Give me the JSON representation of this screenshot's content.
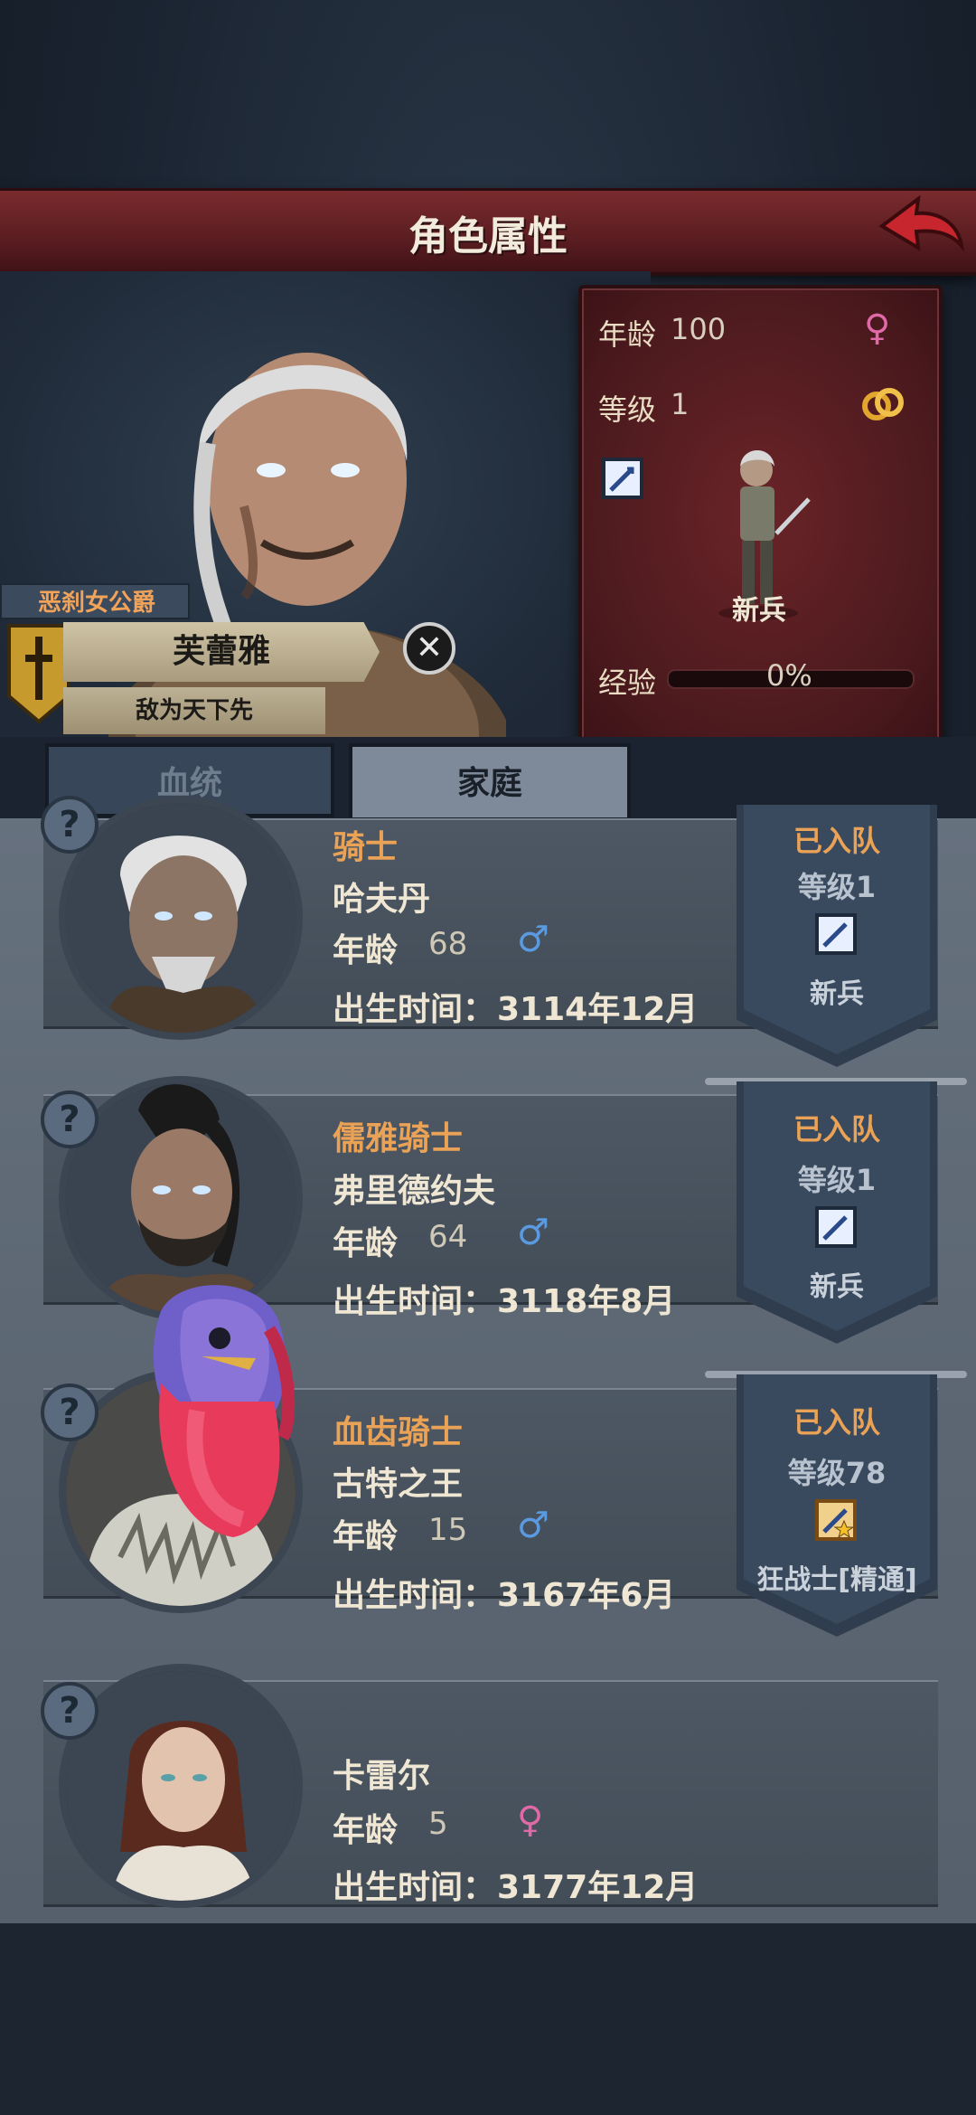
{
  "header": {
    "title": "角色属性"
  },
  "character": {
    "title_tag": "恶刹女公爵",
    "name": "芙蕾雅",
    "motto": "敌为天下先",
    "stats": {
      "age_label": "年龄",
      "age_value": "100",
      "level_label": "等级",
      "level_value": "1",
      "class_name": "新兵",
      "exp_label": "经验",
      "exp_value": "0%",
      "exp_fraction": 0
    }
  },
  "tabs": [
    {
      "label": "血统",
      "active": false
    },
    {
      "label": "家庭",
      "active": true
    }
  ],
  "family": [
    {
      "title": "骑士",
      "name": "哈夫丹",
      "age_label": "年龄",
      "age": "68",
      "gender": "male",
      "birth_label": "出生时间：",
      "birth": "3114年12月",
      "status": "已入队",
      "level": "等级1",
      "class": "新兵",
      "elite": false
    },
    {
      "title": "儒雅骑士",
      "name": "弗里德约夫",
      "age_label": "年龄",
      "age": "64",
      "gender": "male",
      "birth_label": "出生时间：",
      "birth": "3118年8月",
      "status": "已入队",
      "level": "等级1",
      "class": "新兵",
      "elite": false
    },
    {
      "title": "血齿骑士",
      "name": "古特之王",
      "age_label": "年龄",
      "age": "15",
      "gender": "male",
      "birth_label": "出生时间：",
      "birth": "3167年6月",
      "status": "已入队",
      "level": "等级78",
      "class": "狂战士[精通]",
      "elite": true
    },
    {
      "title": "",
      "name": "卡雷尔",
      "age_label": "年龄",
      "age": "5",
      "gender": "female",
      "birth_label": "出生时间：",
      "birth": "3177年12月"
    }
  ],
  "icons": {
    "female": "♀",
    "male": "♂",
    "unknown": "?",
    "close": "✕"
  },
  "colors": {
    "accent_orange": "#e9a256",
    "header_red": "#7a2b2e",
    "male_blue": "#5a9ae0",
    "female_pink": "#e06aa8"
  }
}
